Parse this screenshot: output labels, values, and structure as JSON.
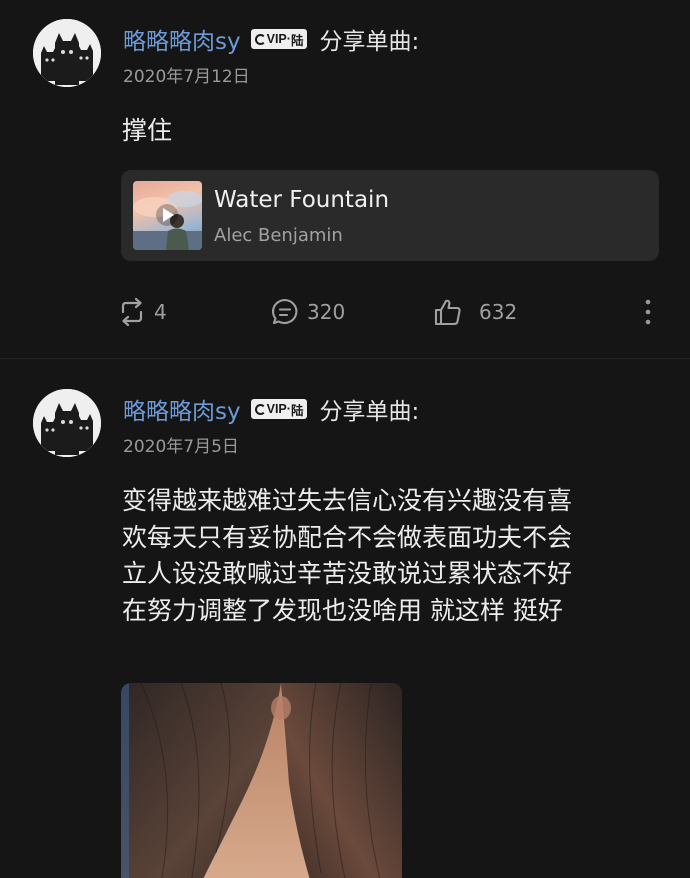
{
  "colors": {
    "background": "#151515",
    "username": "#6d9bd6",
    "card": "#2a2a2a",
    "muted": "#9a9a9a"
  },
  "posts": [
    {
      "username": "略略略肉sy",
      "badge": {
        "vip": "VIP",
        "level": "陆"
      },
      "share_label": "分享单曲:",
      "date": "2020年7月12日",
      "text": "撑住",
      "music": {
        "title": "Water Fountain",
        "artist": "Alec Benjamin",
        "cover_icon": "play-icon"
      },
      "stats": {
        "reposts": "4",
        "comments": "320",
        "likes": "632"
      }
    },
    {
      "username": "略略略肉sy",
      "badge": {
        "vip": "VIP",
        "level": "陆"
      },
      "share_label": "分享单曲:",
      "date": "2020年7月5日",
      "text": "变得越来越难过失去信心没有兴趣没有喜\n欢每天只有妥协配合不会做表面功夫不会\n立人设没敢喊过辛苦没敢说过累状态不好\n在努力调整了发现也没啥用 就这样 挺好"
    }
  ],
  "icons": {
    "repost": "repost-icon",
    "comment": "comment-icon",
    "like": "thumbs-up-icon",
    "more": "more-vertical-icon",
    "avatar": "black-cats-avatar"
  }
}
